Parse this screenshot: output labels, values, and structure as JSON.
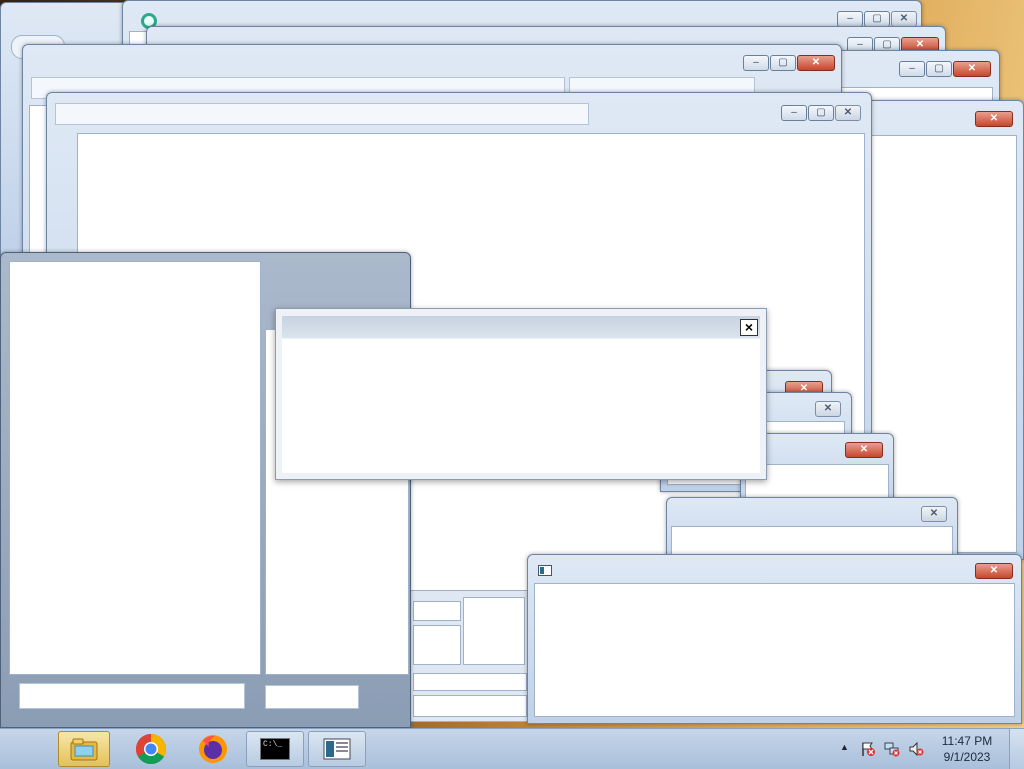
{
  "screen": {
    "description_free": true
  },
  "dialog": {
    "close_label": "×"
  },
  "window_controls": {
    "minimize": "–",
    "maximize": "▢",
    "close": "✕"
  },
  "taskbar": {
    "items": [
      {
        "name": "Windows Explorer",
        "icon": "folder-icon",
        "active": true
      },
      {
        "name": "Google Chrome",
        "icon": "chrome-icon",
        "active": false
      },
      {
        "name": "Firefox",
        "icon": "firefox-icon",
        "active": false
      },
      {
        "name": "Command Prompt",
        "icon": "cmd-icon",
        "active": false
      },
      {
        "name": "Application",
        "icon": "app-window-icon",
        "active": false
      }
    ],
    "cmd_glyph": "C:\\_"
  },
  "tray": {
    "show_hidden_label": "▲",
    "time": "11:47 PM",
    "date": "9/1/2023",
    "icons": [
      "action-center-flag-icon",
      "network-icon",
      "volume-muted-icon"
    ]
  },
  "colors": {
    "taskbar": "#b7cbe3",
    "close_red": "#c7472d",
    "titlebar": "#cfdced"
  }
}
